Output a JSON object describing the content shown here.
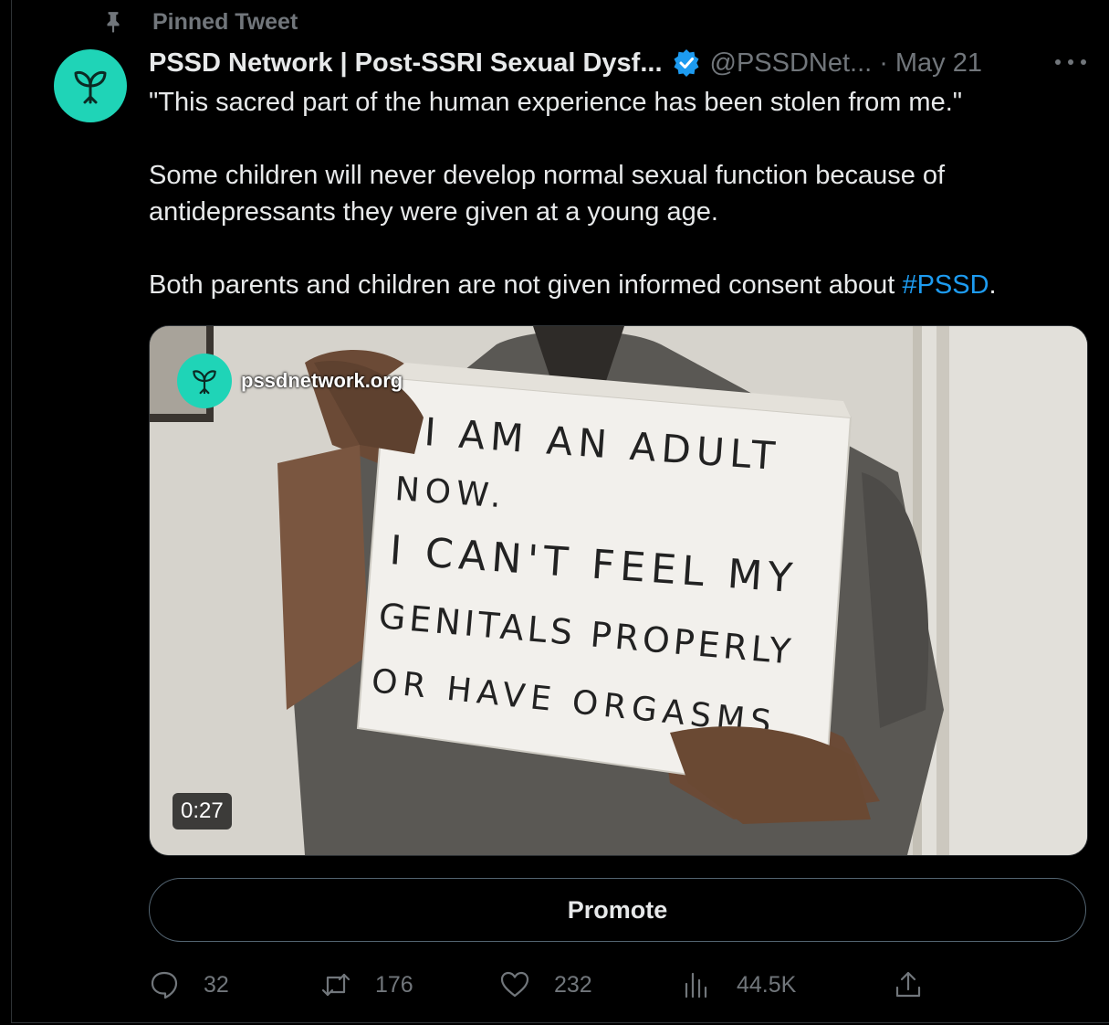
{
  "pinned": {
    "label": "Pinned Tweet"
  },
  "tweet": {
    "author_name": "PSSD Network | Post-SSRI Sexual Dysf...",
    "handle": "@PSSDNet...",
    "separator": "·",
    "date": "May 21",
    "text": {
      "line1": "\"This sacred part of the human experience has been stolen from me.\"",
      "line2": "Some children will never develop normal sexual function because of antidepressants they were given at a young age.",
      "line3_prefix": "Both parents and children are not given informed consent about ",
      "hashtag": "#PSSD",
      "line3_suffix": "."
    }
  },
  "media": {
    "watermark": "pssdnetwork.org",
    "duration": "0:27",
    "sign_lines": [
      "I AM AN ADULT",
      "NOW.",
      "I CAN'T FEEL MY",
      "GENITALS PROPERLY",
      "OR HAVE ORGASMS"
    ]
  },
  "promote": {
    "label": "Promote"
  },
  "actions": {
    "replies": "32",
    "retweets": "176",
    "likes": "232",
    "views": "44.5K"
  },
  "colors": {
    "background": "#000000",
    "text": "#e7e9ea",
    "muted": "#71767b",
    "link": "#1d9bf0",
    "verified": "#1d9bf0",
    "brand": "#1fd4b7"
  },
  "icons": [
    "pin-icon",
    "sprout-logo-icon",
    "verified-badge-icon",
    "more-icon",
    "reply-icon",
    "retweet-icon",
    "like-icon",
    "views-icon",
    "share-icon"
  ]
}
